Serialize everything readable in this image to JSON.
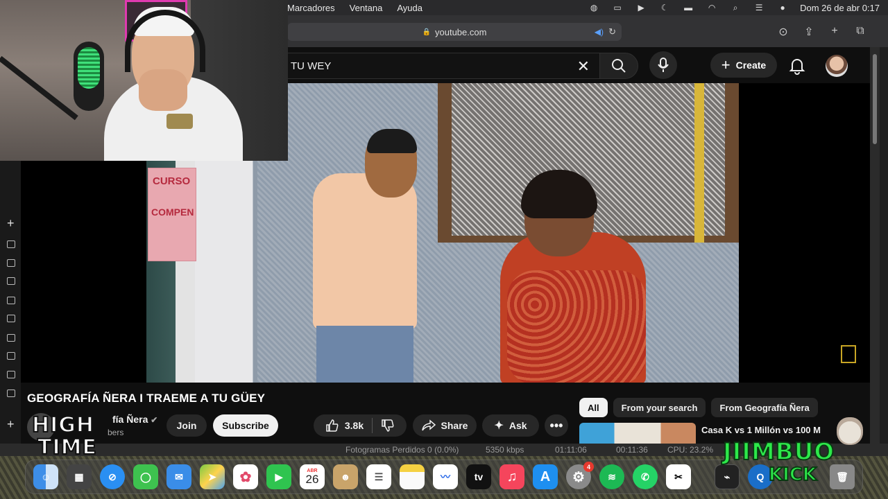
{
  "menubar": {
    "menus": [
      "Marcadores",
      "Ventana",
      "Ayuda"
    ],
    "datetime": "Dom 26 de abr  0:17"
  },
  "browser": {
    "url": "youtube.com"
  },
  "youtube": {
    "search_query": "TU WEY",
    "create_label": "Create",
    "video_title": "GEOGRAFÍA ÑERA I TRAEME A TU GÜEY",
    "channel_name": "fía Ñera",
    "channel_subs": "bers",
    "join_label": "Join",
    "subscribe_label": "Subscribe",
    "likes": "3.8k",
    "share_label": "Share",
    "ask_label": "Ask",
    "chips": [
      "All",
      "From your search",
      "From Geografía Ñera"
    ],
    "active_chip": "All",
    "rec_title": "Casa        K vs 1 Millón vs 100 M"
  },
  "video_frame": {
    "poster_line1": "CURSO",
    "poster_line2": "COMPEN"
  },
  "obs": {
    "dropped": "Fotogramas Perdidos 0 (0.0%)",
    "bitrate": "5350 kbps",
    "time1": "01:11:06",
    "time2": "00:11:36",
    "cpu": "CPU: 23.2%"
  },
  "dock": {
    "calendar_month": "ABR",
    "calendar_day": "26",
    "settings_badge": "4",
    "tv_label": "tv"
  },
  "overlays": {
    "left_logo_line1": "HIGH",
    "left_logo_line2": "TIME",
    "right_logo_line1": "JIIMBUO",
    "right_logo_line2": "KICK"
  },
  "colors": {
    "youtube_bg": "#0f0f0f",
    "pill_bg": "#272727",
    "accent_green": "#2de84a"
  }
}
